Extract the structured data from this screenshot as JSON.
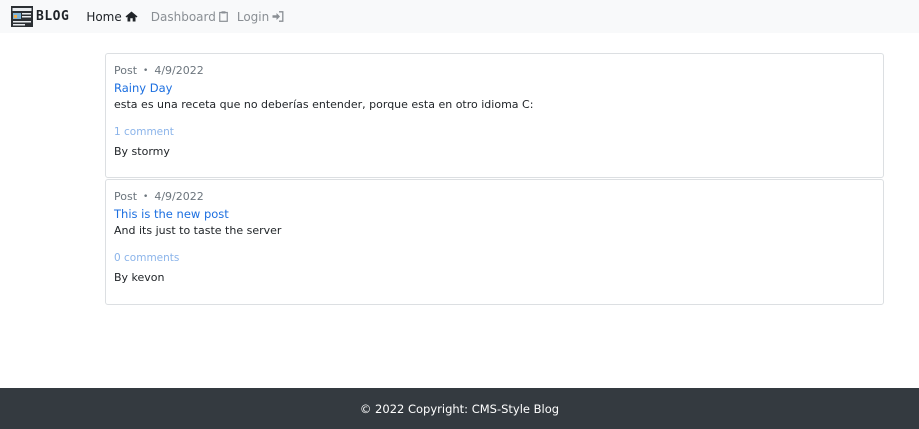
{
  "nav": {
    "brand": "BLOG",
    "links": [
      {
        "label": "Home",
        "icon": "home-icon"
      },
      {
        "label": "Dashboard",
        "icon": "clipboard-icon"
      },
      {
        "label": "Login",
        "icon": "sign-in-icon"
      }
    ]
  },
  "posts": [
    {
      "type": "Post",
      "date": "4/9/2022",
      "title": "Rainy Day",
      "body": "esta es una receta que no deberías entender, porque esta en otro idioma C:",
      "comments": "1 comment",
      "author": "By stormy"
    },
    {
      "type": "Post",
      "date": "4/9/2022",
      "title": "This is the new post",
      "body": "And its just to taste the server",
      "comments": "0 comments",
      "author": "By kevon"
    }
  ],
  "footer": {
    "text": "© 2022 Copyright: CMS-Style Blog"
  },
  "colors": {
    "navbar_bg": "#f8f9fa",
    "link_blue": "#1c6fe0",
    "comments_blue": "#8bb4ea",
    "footer_bg": "#343a40"
  }
}
